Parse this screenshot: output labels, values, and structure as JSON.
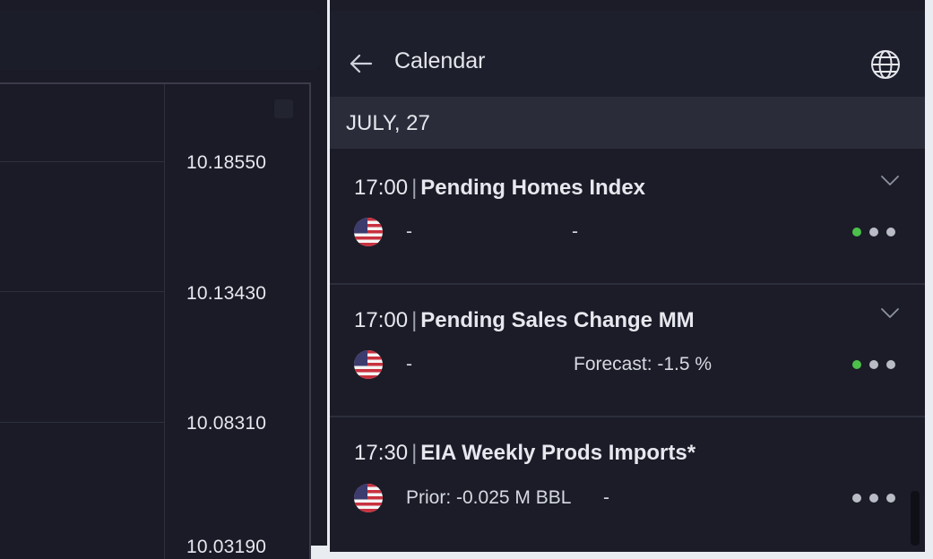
{
  "chart": {
    "price_labels": [
      "10.18550",
      "10.13430",
      "10.08310",
      "10.03190"
    ]
  },
  "calendar": {
    "title": "Calendar",
    "date": "JULY, 27",
    "events": [
      {
        "time": "17:00",
        "separator": "|",
        "name": "Pending Homes Index",
        "country": "US",
        "field_left": "-",
        "field_mid": "-",
        "importance": 1
      },
      {
        "time": "17:00",
        "separator": "|",
        "name": "Pending Sales Change MM",
        "country": "US",
        "field_left": "-",
        "field_mid": "Forecast: -1.5 %",
        "importance": 1
      },
      {
        "time": "17:30",
        "separator": "|",
        "name": "EIA Weekly Prods Imports*",
        "country": "US",
        "field_left": "Prior: -0.025 M BBL",
        "field_mid": "-",
        "importance": 0
      }
    ],
    "icons": {
      "back": "arrow-left-icon",
      "globe": "globe-icon",
      "expand": "chevron-down-icon",
      "flag": "us-flag-icon"
    },
    "colors": {
      "importance_active": "#4cc04a",
      "importance_inactive": "#b9bcc4"
    }
  }
}
